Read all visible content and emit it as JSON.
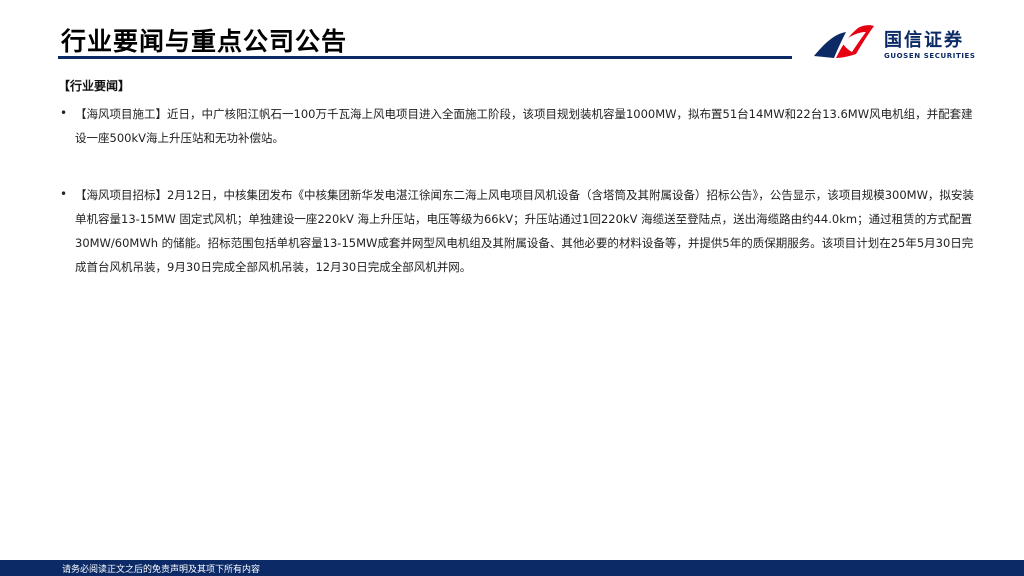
{
  "header": {
    "title": "行业要闻与重点公司公告"
  },
  "logo": {
    "name_cn": "国信证券",
    "name_en": "GUOSEN SECURITIES",
    "colors": {
      "red": "#e60012",
      "navy": "#0b2a66"
    }
  },
  "main": {
    "section_heading": "【行业要闻】",
    "bullet_glyph": "•",
    "items": [
      {
        "text": "【海风项目施工】近日，中广核阳江帆石一100万千瓦海上风电项目进入全面施工阶段，该项目规划装机容量1000MW，拟布置51台14MW和22台13.6MW风电机组，并配套建设一座500kV海上升压站和无功补偿站。"
      },
      {
        "text": "【海风项目招标】2月12日，中核集团发布《中核集团新华发电湛江徐闻东二海上风电项目风机设备（含塔筒及其附属设备）招标公告》，公告显示，该项目规模300MW，拟安装单机容量13-15MW 固定式风机；单独建设一座220kV 海上升压站，电压等级为66kV；升压站通过1回220kV 海缆送至登陆点，送出海缆路由约44.0km；通过租赁的方式配置30MW/60MWh 的储能。招标范围包括单机容量13-15MW成套并网型风电机组及其附属设备、其他必要的材料设备等，并提供5年的质保期服务。该项目计划在25年5月30日完成首台风机吊装，9月30日完成全部风机吊装，12月30日完成全部风机并网。"
      }
    ]
  },
  "footer": {
    "disclaimer": "请务必阅读正文之后的免责声明及其项下所有内容",
    "color": "#0b2a66"
  }
}
